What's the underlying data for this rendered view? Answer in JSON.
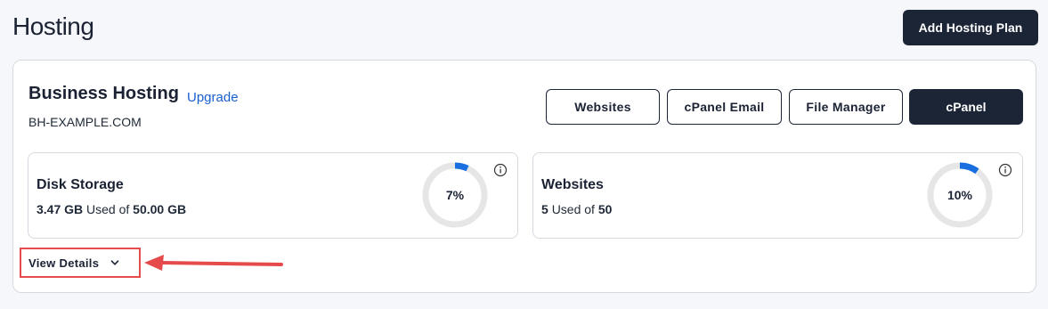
{
  "header": {
    "title": "Hosting",
    "add_button": "Add Hosting Plan"
  },
  "plan": {
    "name": "Business Hosting",
    "upgrade": "Upgrade",
    "domain": "BH-EXAMPLE.COM",
    "actions": [
      "Websites",
      "cPanel Email",
      "File Manager",
      "cPanel"
    ]
  },
  "stats": {
    "disk": {
      "title": "Disk Storage",
      "used": "3.47 GB",
      "used_of": "Used of",
      "total": "50.00 GB",
      "percent_label": "7%",
      "percent": 7
    },
    "websites": {
      "title": "Websites",
      "used": "5",
      "used_of": "Used of",
      "total": "50",
      "percent_label": "10%",
      "percent": 10
    }
  },
  "view_details": "View Details",
  "colors": {
    "accent_blue": "#1a6fe0",
    "ring_track": "#e6e6e6",
    "dark_button": "#1c2536",
    "annotation_red": "#e54b4b"
  },
  "icons": {
    "info": "info-icon",
    "chevron": "chevron-down-icon",
    "arrow": "annotation-arrow-icon"
  }
}
